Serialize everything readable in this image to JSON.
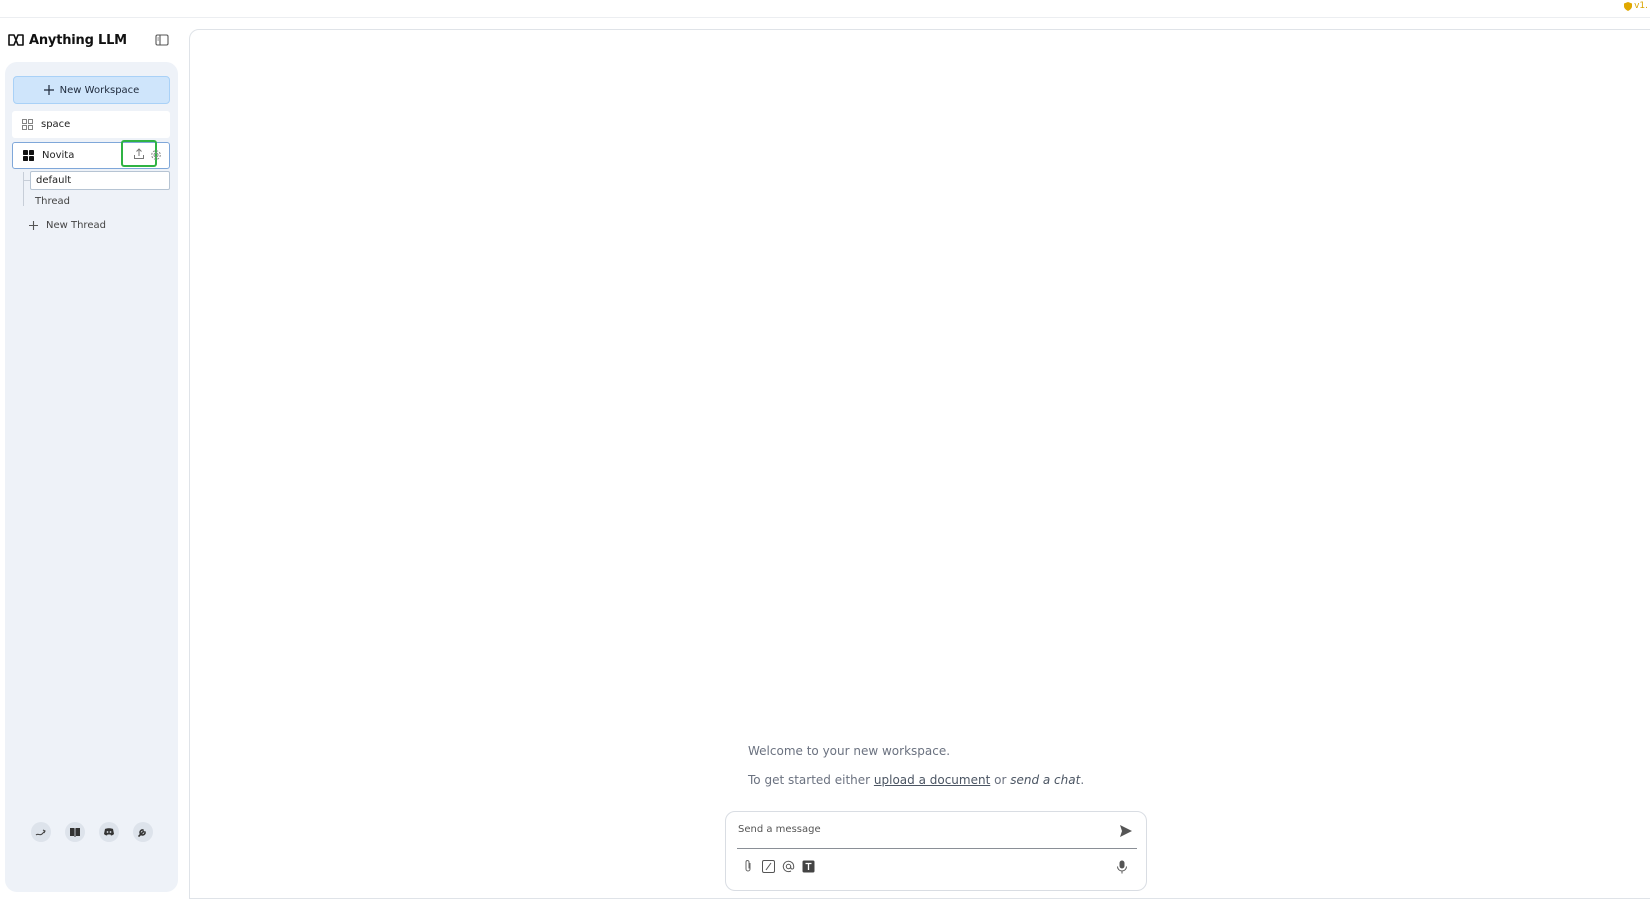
{
  "app": {
    "title": "Anything LLM",
    "version": "v1."
  },
  "sidebar": {
    "new_workspace_label": "New Workspace",
    "workspaces": [
      {
        "name": "space",
        "active": false
      },
      {
        "name": "Novita",
        "active": true
      }
    ],
    "threads": [
      {
        "name": "default",
        "selected": true
      },
      {
        "name": "Thread",
        "selected": false
      }
    ],
    "new_thread_label": "New Thread",
    "footer_icons": [
      "community-icon",
      "docs-book-icon",
      "discord-icon",
      "settings-wrench-icon"
    ]
  },
  "main": {
    "welcome_text": "Welcome to your new workspace.",
    "get_started_prefix": "To get started either ",
    "upload_link": "upload a document",
    "or_text": " or ",
    "send_chat": "send a chat",
    "period": "."
  },
  "composer": {
    "placeholder": "Send a message",
    "tools": [
      "attach-icon",
      "slash-command-icon",
      "mention-icon",
      "text-format-icon"
    ]
  },
  "colors": {
    "sidebar_bg": "#eef2f8",
    "new_workspace_bg": "#cfe5fb",
    "highlight_green": "#2fb344",
    "version_gold": "#d9a400"
  }
}
